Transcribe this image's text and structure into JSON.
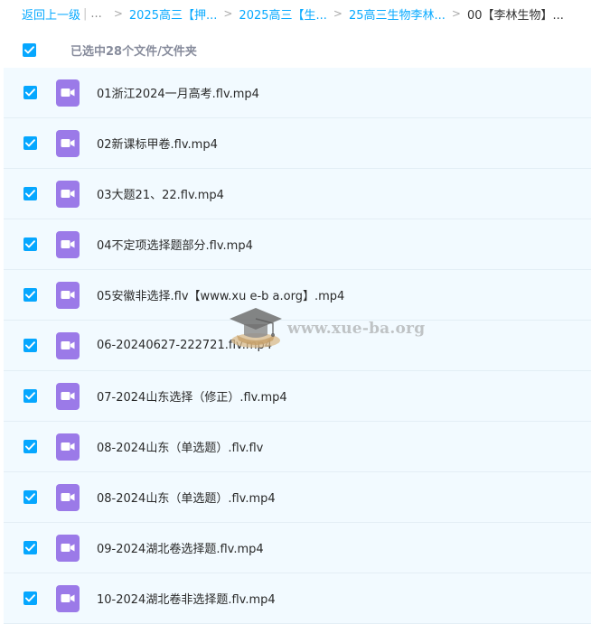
{
  "breadcrumb": {
    "back_label": "返回上一级",
    "separator_bar": "|",
    "ellipsis": "...",
    "separator": ">",
    "items": [
      {
        "label": "2025高三【押..."
      },
      {
        "label": "2025高三【生..."
      },
      {
        "label": "25高三生物李林..."
      }
    ],
    "current": "00【李林生物】..."
  },
  "selection": {
    "text": "已选中28个文件/文件夹",
    "all_checked": true
  },
  "files": [
    {
      "name": "01浙江2024一月高考.flv.mp4",
      "checked": true,
      "icon": "video-file-icon"
    },
    {
      "name": "02新课标甲卷.flv.mp4",
      "checked": true,
      "icon": "video-file-icon"
    },
    {
      "name": "03大题21、22.flv.mp4",
      "checked": true,
      "icon": "video-file-icon"
    },
    {
      "name": "04不定项选择题部分.flv.mp4",
      "checked": true,
      "icon": "video-file-icon"
    },
    {
      "name": "05安徽非选择.flv【www.xu e-b a.org】.mp4",
      "checked": true,
      "icon": "video-file-icon"
    },
    {
      "name": "06-20240627-222721.flv.mp4",
      "checked": true,
      "icon": "video-file-icon"
    },
    {
      "name": "07-2024山东选择（修正）.flv.mp4",
      "checked": true,
      "icon": "video-file-icon"
    },
    {
      "name": "08-2024山东（单选题）.flv.flv",
      "checked": true,
      "icon": "video-file-icon"
    },
    {
      "name": "08-2024山东（单选题）.flv.mp4",
      "checked": true,
      "icon": "video-file-icon"
    },
    {
      "name": "09-2024湖北卷选择题.flv.mp4",
      "checked": true,
      "icon": "video-file-icon"
    },
    {
      "name": "10-2024湖北卷非选择题.flv.mp4",
      "checked": true,
      "icon": "video-file-icon"
    }
  ],
  "watermark": {
    "text": "www.xue-ba.org"
  },
  "colors": {
    "accent": "#06a7ff",
    "link": "#09aaff",
    "video_icon": "#9b7ae8",
    "list_bg": "#f2faff"
  }
}
